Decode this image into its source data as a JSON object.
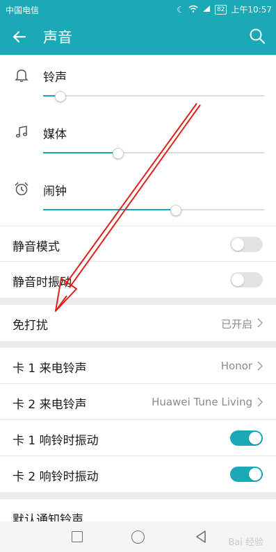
{
  "status": {
    "carrier": "中国电信",
    "battery": "82",
    "time": "上午10:57"
  },
  "header": {
    "title": "声音"
  },
  "volumes": [
    {
      "label": "铃声",
      "icon": "bell-icon",
      "level": 0.08
    },
    {
      "label": "媒体",
      "icon": "music-note-icon",
      "level": 0.34
    },
    {
      "label": "闹钟",
      "icon": "alarm-clock-icon",
      "level": 0.6
    }
  ],
  "toggles": {
    "silent_mode": {
      "label": "静音模式",
      "on": false
    },
    "silent_vibrate": {
      "label": "静音时振动",
      "on": false
    }
  },
  "dnd": {
    "label": "免打扰",
    "value": "已开启"
  },
  "sim": {
    "card1_ringtone": {
      "label": "卡 1 来电铃声",
      "value": "Honor"
    },
    "card2_ringtone": {
      "label": "卡 2 来电铃声",
      "value": "Huawei Tune Living"
    },
    "card1_vibrate": {
      "label": "卡 1 响铃时振动",
      "on": true
    },
    "card2_vibrate": {
      "label": "卡 2 响铃时振动",
      "on": true
    }
  },
  "notification": {
    "label": "默认通知铃声"
  },
  "watermark": "Bai 经验",
  "colors": {
    "accent": "#1ba9b8",
    "annotation": "#e0201c"
  }
}
